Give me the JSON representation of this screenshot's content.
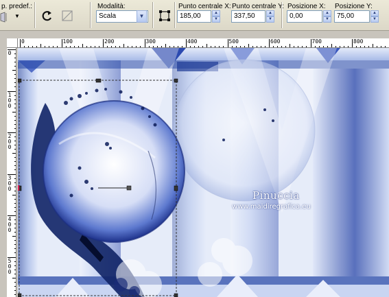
{
  "toolbar": {
    "preset_label": "p. predef.:",
    "mode_label": "Modalità:",
    "mode_value": "Scala",
    "center_x_label": "Punto centrale X:",
    "center_x_value": "185,00",
    "center_y_label": "Punto centrale Y:",
    "center_y_value": "337,50",
    "pos_x_label": "Posizione X:",
    "pos_x_value": "0,00",
    "pos_y_label": "Posizione Y:",
    "pos_y_value": "75,00"
  },
  "ruler_top": {
    "labels": [
      "0",
      "100",
      "200",
      "300",
      "400",
      "500",
      "600",
      "700",
      "800"
    ]
  },
  "ruler_left": {
    "labels": [
      "0",
      "1 0 0",
      "2 0 0",
      "3 0 0",
      "4 0 0",
      "5 0 0"
    ]
  },
  "canvas": {
    "watermark_name": "Pinuccia",
    "watermark_url": "www.maidiregrafica.eu",
    "accent_colors": [
      "#1a3a9a",
      "#3b5fc9",
      "#eef2fb",
      "#0d1d5a"
    ]
  },
  "icons": [
    "preset-icon",
    "rotate-icon",
    "flip-icon",
    "transform-icon"
  ]
}
